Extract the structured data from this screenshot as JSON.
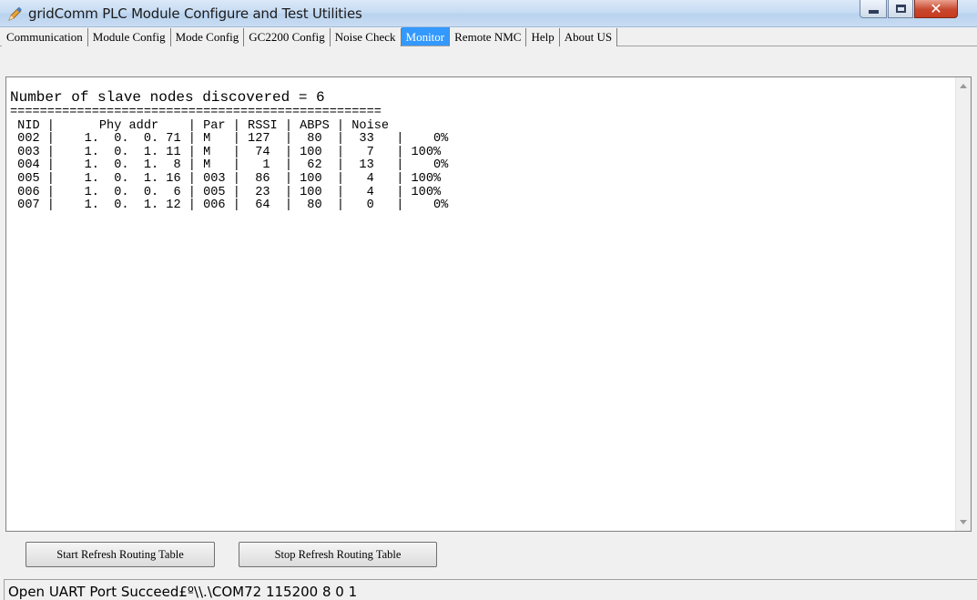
{
  "window": {
    "title": "gridComm PLC Module Configure and Test Utilities",
    "icon": "pencil-app-icon"
  },
  "tabs": [
    {
      "label": "Communication",
      "active": false
    },
    {
      "label": "Module Config",
      "active": false
    },
    {
      "label": "Mode Config",
      "active": false
    },
    {
      "label": "GC2200 Config",
      "active": false
    },
    {
      "label": "Noise Check",
      "active": false
    },
    {
      "label": "Monitor",
      "active": true
    },
    {
      "label": "Remote NMC",
      "active": false
    },
    {
      "label": "Help",
      "active": false
    },
    {
      "label": "About US",
      "active": false
    }
  ],
  "monitor": {
    "summary": "Number of slave nodes discovered = 6",
    "separator": "==================================================",
    "table_header": " NID |      Phy addr    | Par | RSSI | ABPS | Noise",
    "rows": [
      " 002 |    1.  0.  0. 71 | M   | 127  |  80  |  33   |    0%",
      " 003 |    1.  0.  1. 11 | M   |  74  | 100  |   7   | 100%",
      " 004 |    1.  0.  1.  8 | M   |   1  |  62  |  13   |    0%",
      " 005 |    1.  0.  1. 16 | 003 |  86  | 100  |   4   | 100%",
      " 006 |    1.  0.  0.  6 | 005 |  23  | 100  |   4   | 100%",
      " 007 |    1.  0.  1. 12 | 006 |  64  |  80  |   0   |    0%"
    ]
  },
  "buttons": {
    "start_refresh": "Start Refresh Routing Table",
    "stop_refresh": "Stop Refresh Routing Table"
  },
  "status": {
    "text": "Open UART Port Succeed£º\\\\.\\COM72 115200 8 0 1"
  },
  "colors": {
    "active_tab": "#3399ff",
    "close_button": "#c73a1f"
  }
}
